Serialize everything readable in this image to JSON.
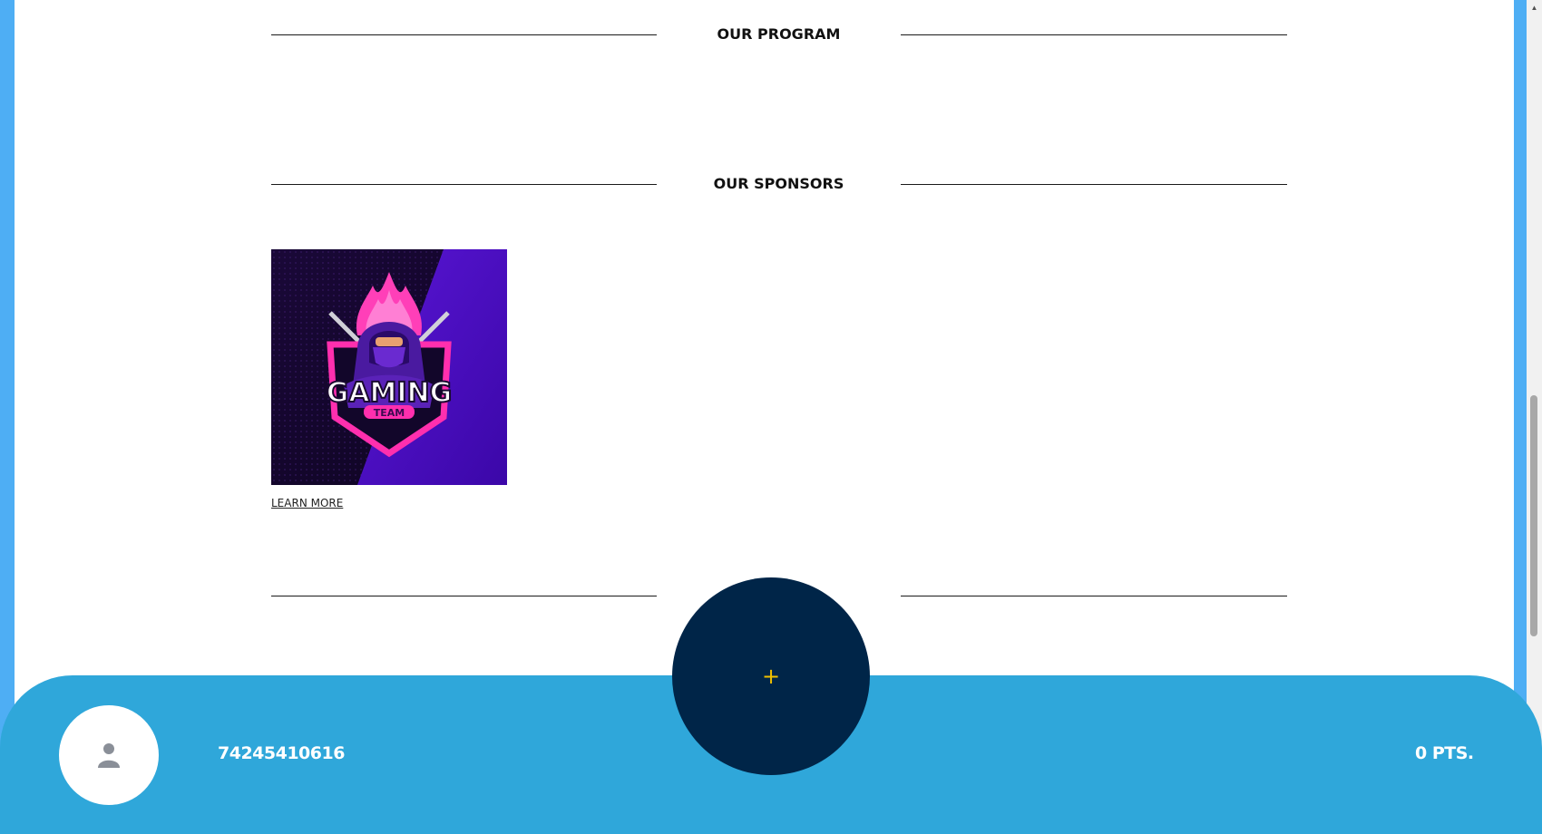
{
  "sections": {
    "program_title": "OUR PROGRAM",
    "sponsors_title": "OUR SPONSORS"
  },
  "sponsor": {
    "logo_text": "GAMING",
    "logo_subtext": "TEAM",
    "learn_more": "LEARN MORE"
  },
  "footer": {
    "user_id": "74245410616",
    "points": "0 PTS.",
    "fab_symbol": "+"
  },
  "colors": {
    "page_bg": "#ffffff",
    "outer_bg": "#4eaef4",
    "bottom_bar": "#2fa7da",
    "fab": "#002548",
    "fab_icon": "#f0c000"
  },
  "icons": {
    "avatar": "person-icon",
    "fab": "plus-icon",
    "scroll": "scroll-up-arrow"
  }
}
